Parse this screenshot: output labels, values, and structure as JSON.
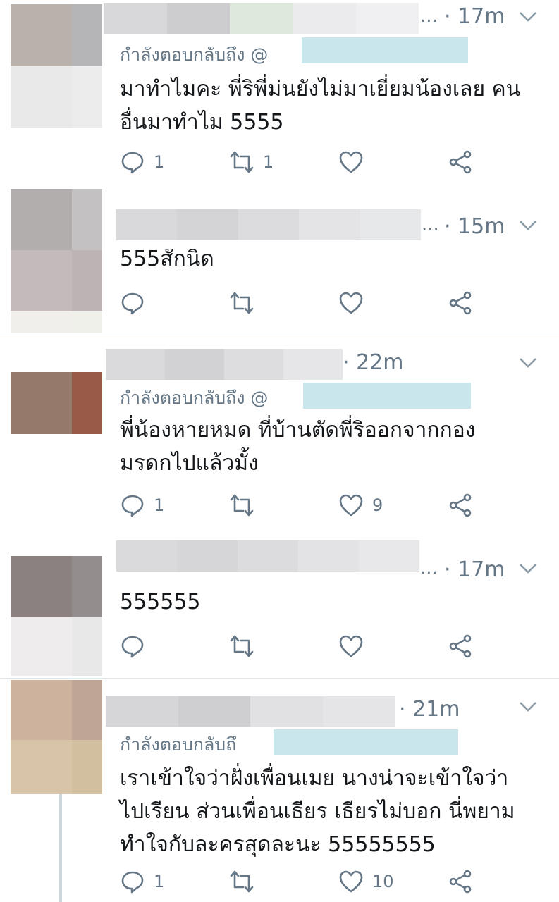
{
  "colors": {
    "text_primary": "#14171a",
    "text_secondary": "#657786",
    "separator": "#e1e8ed",
    "mention_redaction": "#c9e6ec"
  },
  "icons": {
    "reply": "reply-bubble-icon",
    "retweet": "retweet-icon",
    "like": "heart-icon",
    "share": "share-icon",
    "menu": "chevron-down-icon"
  },
  "tweets": [
    {
      "time": "· 17m",
      "ellipsis": "...",
      "reply_label": "กำลังตอบกลับถึง @",
      "text": "มาทำไมคะ พี่ริพี่ม่นยังไม่มาเยี่ยมน้องเลย คน\nอื่นมาทำไม 5555",
      "reply_count": "1",
      "retweet_count": "1",
      "like_count": ""
    },
    {
      "time": "· 15m",
      "ellipsis": "...",
      "reply_label": "",
      "text": "555สักนิด",
      "reply_count": "",
      "retweet_count": "",
      "like_count": ""
    },
    {
      "time": "· 22m",
      "ellipsis": "",
      "reply_label": "กำลังตอบกลับถึง @",
      "text": "พี่น้องหายหมด ที่บ้านตัดพี่ริออกจากกอง\nมรดกไปแล้วมั้ง",
      "reply_count": "1",
      "retweet_count": "",
      "like_count": "9"
    },
    {
      "time": "· 17m",
      "ellipsis": "...",
      "reply_label": "",
      "text": "555555",
      "reply_count": "",
      "retweet_count": "",
      "like_count": ""
    },
    {
      "time": "· 21m",
      "ellipsis": "",
      "reply_label": "กำลังตอบกลับถึ",
      "text": "เราเข้าใจว่าฝั่งเพื่อนเมย นางน่าจะเข้าใจว่า\nไปเรียน ส่วนเพื่อนเธียร เธียรไม่บอก นี่พยาม\nทำใจกับละครสุดละนะ 55555555",
      "reply_count": "1",
      "retweet_count": "",
      "like_count": "10"
    }
  ]
}
